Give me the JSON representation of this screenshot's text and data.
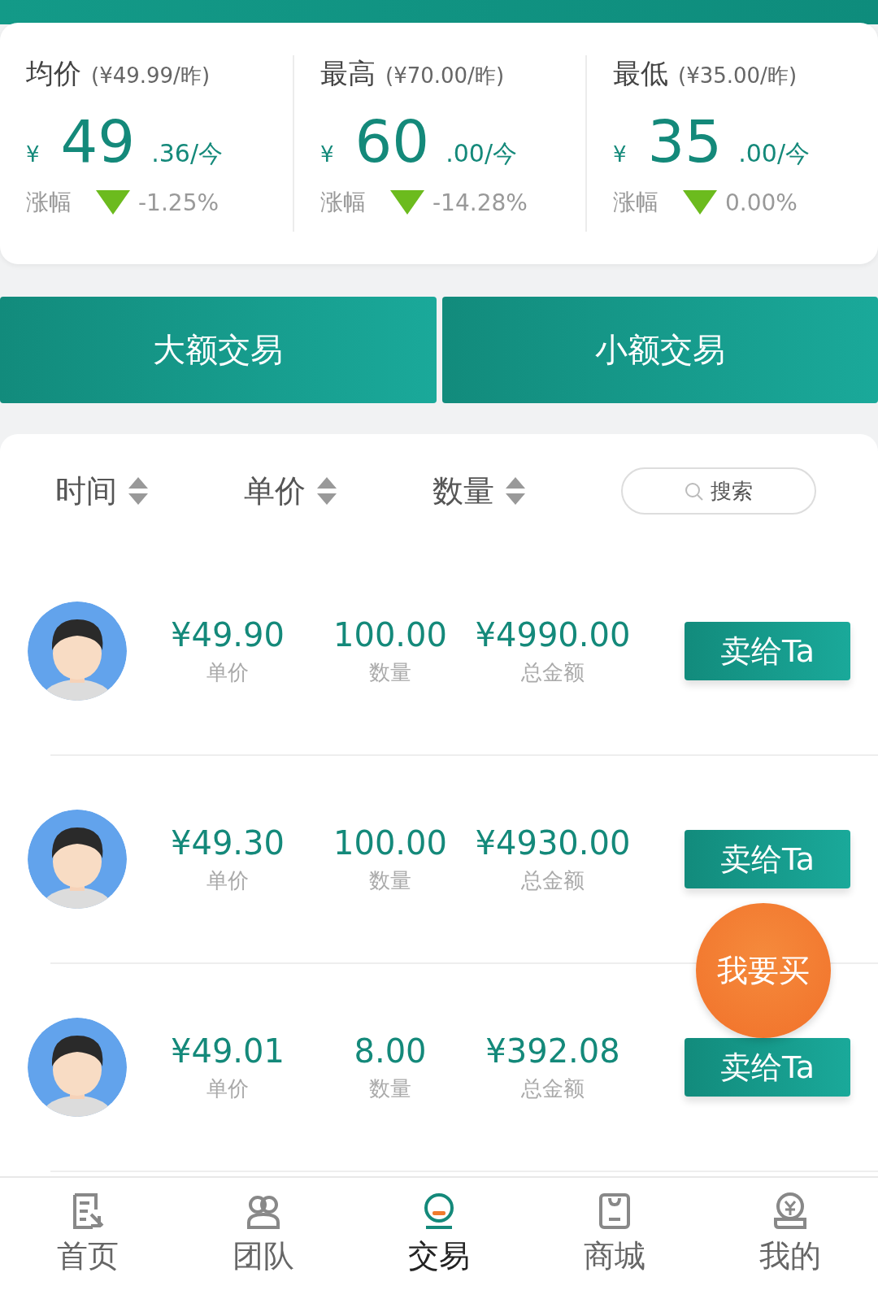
{
  "stats": [
    {
      "label": "均价",
      "previous": "(¥49.99/昨)",
      "currency": "¥",
      "whole": "49",
      "fraction": ".36/今",
      "change_label": "涨幅",
      "change": "-1.25%",
      "kind": "down"
    },
    {
      "label": "最高",
      "previous": "(¥70.00/昨)",
      "currency": "¥",
      "whole": "60",
      "fraction": ".00/今",
      "change_label": "涨幅",
      "change": "-14.28%",
      "kind": "down"
    },
    {
      "label": "最低",
      "previous": "(¥35.00/昨)",
      "currency": "¥",
      "whole": "35",
      "fraction": ".00/今",
      "change_label": "涨幅",
      "change": "0.00%",
      "kind": "down"
    }
  ],
  "trade_types": [
    "大额交易",
    "小额交易"
  ],
  "sort_columns": [
    "时间",
    "单价",
    "数量"
  ],
  "search": {
    "placeholder": "搜索"
  },
  "orders": [
    {
      "price": "¥49.90",
      "price_label": "单价",
      "quantity": "100.00",
      "quantity_label": "数量",
      "total": "¥4990.00",
      "total_label": "总金额",
      "action": "卖给Ta"
    },
    {
      "price": "¥49.30",
      "price_label": "单价",
      "quantity": "100.00",
      "quantity_label": "数量",
      "total": "¥4930.00",
      "total_label": "总金额",
      "action": "卖给Ta"
    },
    {
      "price": "¥49.01",
      "price_label": "单价",
      "quantity": "8.00",
      "quantity_label": "数量",
      "total": "¥392.08",
      "total_label": "总金额",
      "action": "卖给Ta"
    }
  ],
  "buy_button": "我要买",
  "tab_bar": [
    {
      "label": "首页",
      "kind": "home",
      "selected": false
    },
    {
      "label": "团队",
      "kind": "team",
      "selected": false
    },
    {
      "label": "交易",
      "kind": "trade",
      "selected": true
    },
    {
      "label": "商城",
      "kind": "shop",
      "selected": false
    },
    {
      "label": "我的",
      "kind": "mine",
      "selected": false
    }
  ]
}
